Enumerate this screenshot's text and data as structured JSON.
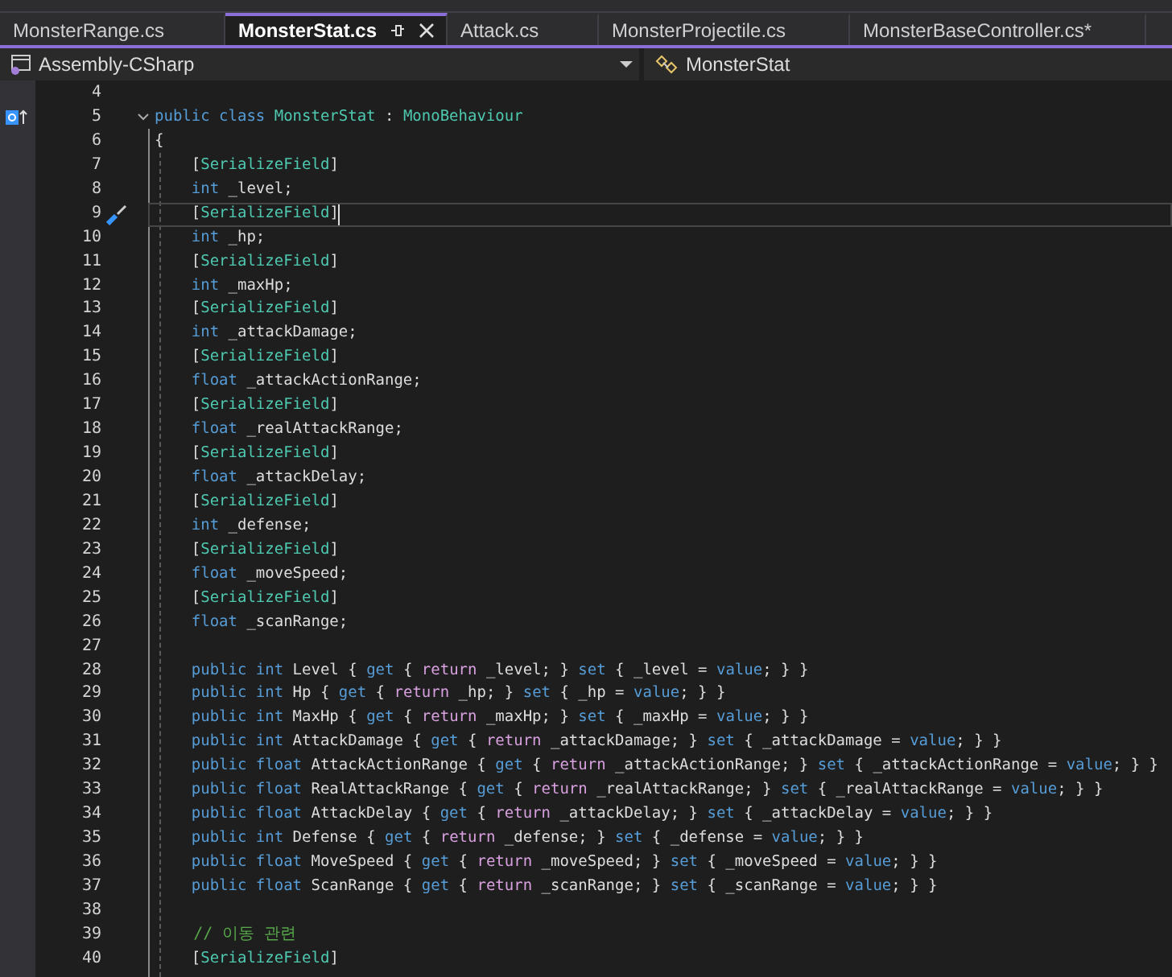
{
  "tabs": [
    {
      "label": "MonsterRange.cs",
      "selected": false
    },
    {
      "label": "MonsterStat.cs",
      "selected": true
    },
    {
      "label": "Attack.cs",
      "selected": false
    },
    {
      "label": "MonsterProjectile.cs",
      "selected": false
    },
    {
      "label": "MonsterBaseController.cs*",
      "selected": false
    }
  ],
  "navigation": {
    "project": "Assembly-CSharp",
    "type": "MonsterStat"
  },
  "lines": [
    {
      "number": "4",
      "kind": "plain",
      "current": false
    },
    {
      "number": "5",
      "kind": "declaration",
      "current": false,
      "tokens": [
        {
          "kind": "kw",
          "t": "public class "
        },
        {
          "kind": "type",
          "t": "MonsterStat"
        },
        {
          "kind": "plain",
          "t": " : "
        },
        {
          "kind": "type",
          "t": "MonoBehaviour"
        }
      ]
    },
    {
      "number": "6",
      "kind": "plain",
      "current": false,
      "tokens": [
        {
          "kind": "plain",
          "t": "{"
        }
      ]
    },
    {
      "number": "7",
      "kind": "plain",
      "current": false,
      "tokens": [
        {
          "kind": "plain",
          "t": "    ["
        },
        {
          "kind": "attr",
          "t": "SerializeField"
        },
        {
          "kind": "plain",
          "t": "]"
        }
      ]
    },
    {
      "number": "8",
      "kind": "plain",
      "current": false,
      "tokens": [
        {
          "kind": "kw",
          "t": "    int"
        },
        {
          "kind": "plain",
          "t": " _level;"
        }
      ]
    },
    {
      "number": "9",
      "kind": "quick-action",
      "current": true,
      "tokens": [
        {
          "kind": "plain",
          "t": "    ["
        },
        {
          "kind": "attr",
          "t": "SerializeField"
        },
        {
          "kind": "plain",
          "t": "]"
        }
      ]
    },
    {
      "number": "10",
      "kind": "plain",
      "current": false,
      "tokens": [
        {
          "kind": "kw",
          "t": "    int"
        },
        {
          "kind": "plain",
          "t": " _hp;"
        }
      ]
    },
    {
      "number": "11",
      "kind": "plain",
      "current": false,
      "tokens": [
        {
          "kind": "plain",
          "t": "    ["
        },
        {
          "kind": "attr",
          "t": "SerializeField"
        },
        {
          "kind": "plain",
          "t": "]"
        }
      ]
    },
    {
      "number": "12",
      "kind": "plain",
      "current": false,
      "tokens": [
        {
          "kind": "kw",
          "t": "    int"
        },
        {
          "kind": "plain",
          "t": " _maxHp;"
        }
      ]
    },
    {
      "number": "13",
      "kind": "plain",
      "current": false,
      "tokens": [
        {
          "kind": "plain",
          "t": "    ["
        },
        {
          "kind": "attr",
          "t": "SerializeField"
        },
        {
          "kind": "plain",
          "t": "]"
        }
      ]
    },
    {
      "number": "14",
      "kind": "plain",
      "current": false,
      "tokens": [
        {
          "kind": "kw",
          "t": "    int"
        },
        {
          "kind": "plain",
          "t": " _attackDamage;"
        }
      ]
    },
    {
      "number": "15",
      "kind": "plain",
      "current": false,
      "tokens": [
        {
          "kind": "plain",
          "t": "    ["
        },
        {
          "kind": "attr",
          "t": "SerializeField"
        },
        {
          "kind": "plain",
          "t": "]"
        }
      ]
    },
    {
      "number": "16",
      "kind": "plain",
      "current": false,
      "tokens": [
        {
          "kind": "kw",
          "t": "    float"
        },
        {
          "kind": "plain",
          "t": " _attackActionRange;"
        }
      ]
    },
    {
      "number": "17",
      "kind": "plain",
      "current": false,
      "tokens": [
        {
          "kind": "plain",
          "t": "    ["
        },
        {
          "kind": "attr",
          "t": "SerializeField"
        },
        {
          "kind": "plain",
          "t": "]"
        }
      ]
    },
    {
      "number": "18",
      "kind": "plain",
      "current": false,
      "tokens": [
        {
          "kind": "kw",
          "t": "    float"
        },
        {
          "kind": "plain",
          "t": " _realAttackRange;"
        }
      ]
    },
    {
      "number": "19",
      "kind": "plain",
      "current": false,
      "tokens": [
        {
          "kind": "plain",
          "t": "    ["
        },
        {
          "kind": "attr",
          "t": "SerializeField"
        },
        {
          "kind": "plain",
          "t": "]"
        }
      ]
    },
    {
      "number": "20",
      "kind": "plain",
      "current": false,
      "tokens": [
        {
          "kind": "kw",
          "t": "    float"
        },
        {
          "kind": "plain",
          "t": " _attackDelay;"
        }
      ]
    },
    {
      "number": "21",
      "kind": "plain",
      "current": false,
      "tokens": [
        {
          "kind": "plain",
          "t": "    ["
        },
        {
          "kind": "attr",
          "t": "SerializeField"
        },
        {
          "kind": "plain",
          "t": "]"
        }
      ]
    },
    {
      "number": "22",
      "kind": "plain",
      "current": false,
      "tokens": [
        {
          "kind": "kw",
          "t": "    int"
        },
        {
          "kind": "plain",
          "t": " _defense;"
        }
      ]
    },
    {
      "number": "23",
      "kind": "plain",
      "current": false,
      "tokens": [
        {
          "kind": "plain",
          "t": "    ["
        },
        {
          "kind": "attr",
          "t": "SerializeField"
        },
        {
          "kind": "plain",
          "t": "]"
        }
      ]
    },
    {
      "number": "24",
      "kind": "plain",
      "current": false,
      "tokens": [
        {
          "kind": "kw",
          "t": "    float"
        },
        {
          "kind": "plain",
          "t": " _moveSpeed;"
        }
      ]
    },
    {
      "number": "25",
      "kind": "plain",
      "current": false,
      "tokens": [
        {
          "kind": "plain",
          "t": "    ["
        },
        {
          "kind": "attr",
          "t": "SerializeField"
        },
        {
          "kind": "plain",
          "t": "]"
        }
      ]
    },
    {
      "number": "26",
      "kind": "plain",
      "current": false,
      "tokens": [
        {
          "kind": "kw",
          "t": "    float"
        },
        {
          "kind": "plain",
          "t": " _scanRange;"
        }
      ]
    },
    {
      "number": "27",
      "kind": "plain",
      "current": false
    },
    {
      "number": "28",
      "kind": "plain",
      "current": false,
      "tokens": [
        {
          "kind": "kw",
          "t": "    public int"
        },
        {
          "kind": "plain",
          "t": " Level { "
        },
        {
          "kind": "kw",
          "t": "get"
        },
        {
          "kind": "plain",
          "t": " { "
        },
        {
          "kind": "ctrl",
          "t": "return"
        },
        {
          "kind": "plain",
          "t": " _level; } "
        },
        {
          "kind": "kw",
          "t": "set"
        },
        {
          "kind": "plain",
          "t": " { _level = "
        },
        {
          "kind": "kw",
          "t": "value"
        },
        {
          "kind": "plain",
          "t": "; } }"
        }
      ]
    },
    {
      "number": "29",
      "kind": "plain",
      "current": false,
      "tokens": [
        {
          "kind": "kw",
          "t": "    public int"
        },
        {
          "kind": "plain",
          "t": " Hp { "
        },
        {
          "kind": "kw",
          "t": "get"
        },
        {
          "kind": "plain",
          "t": " { "
        },
        {
          "kind": "ctrl",
          "t": "return"
        },
        {
          "kind": "plain",
          "t": " _hp; } "
        },
        {
          "kind": "kw",
          "t": "set"
        },
        {
          "kind": "plain",
          "t": " { _hp = "
        },
        {
          "kind": "kw",
          "t": "value"
        },
        {
          "kind": "plain",
          "t": "; } }"
        }
      ]
    },
    {
      "number": "30",
      "kind": "plain",
      "current": false,
      "tokens": [
        {
          "kind": "kw",
          "t": "    public int"
        },
        {
          "kind": "plain",
          "t": " MaxHp { "
        },
        {
          "kind": "kw",
          "t": "get"
        },
        {
          "kind": "plain",
          "t": " { "
        },
        {
          "kind": "ctrl",
          "t": "return"
        },
        {
          "kind": "plain",
          "t": " _maxHp; } "
        },
        {
          "kind": "kw",
          "t": "set"
        },
        {
          "kind": "plain",
          "t": " { _maxHp = "
        },
        {
          "kind": "kw",
          "t": "value"
        },
        {
          "kind": "plain",
          "t": "; } }"
        }
      ]
    },
    {
      "number": "31",
      "kind": "plain",
      "current": false,
      "tokens": [
        {
          "kind": "kw",
          "t": "    public int"
        },
        {
          "kind": "plain",
          "t": " AttackDamage { "
        },
        {
          "kind": "kw",
          "t": "get"
        },
        {
          "kind": "plain",
          "t": " { "
        },
        {
          "kind": "ctrl",
          "t": "return"
        },
        {
          "kind": "plain",
          "t": " _attackDamage; } "
        },
        {
          "kind": "kw",
          "t": "set"
        },
        {
          "kind": "plain",
          "t": " { _attackDamage = "
        },
        {
          "kind": "kw",
          "t": "value"
        },
        {
          "kind": "plain",
          "t": "; } }"
        }
      ]
    },
    {
      "number": "32",
      "kind": "plain",
      "current": false,
      "tokens": [
        {
          "kind": "kw",
          "t": "    public float"
        },
        {
          "kind": "plain",
          "t": " AttackActionRange { "
        },
        {
          "kind": "kw",
          "t": "get"
        },
        {
          "kind": "plain",
          "t": " { "
        },
        {
          "kind": "ctrl",
          "t": "return"
        },
        {
          "kind": "plain",
          "t": " _attackActionRange; } "
        },
        {
          "kind": "kw",
          "t": "set"
        },
        {
          "kind": "plain",
          "t": " { _attackActionRange = "
        },
        {
          "kind": "kw",
          "t": "value"
        },
        {
          "kind": "plain",
          "t": "; } }"
        }
      ]
    },
    {
      "number": "33",
      "kind": "plain",
      "current": false,
      "tokens": [
        {
          "kind": "kw",
          "t": "    public float"
        },
        {
          "kind": "plain",
          "t": " RealAttackRange { "
        },
        {
          "kind": "kw",
          "t": "get"
        },
        {
          "kind": "plain",
          "t": " { "
        },
        {
          "kind": "ctrl",
          "t": "return"
        },
        {
          "kind": "plain",
          "t": " _realAttackRange; } "
        },
        {
          "kind": "kw",
          "t": "set"
        },
        {
          "kind": "plain",
          "t": " { _realAttackRange = "
        },
        {
          "kind": "kw",
          "t": "value"
        },
        {
          "kind": "plain",
          "t": "; } }"
        }
      ]
    },
    {
      "number": "34",
      "kind": "plain",
      "current": false,
      "tokens": [
        {
          "kind": "kw",
          "t": "    public float"
        },
        {
          "kind": "plain",
          "t": " AttackDelay { "
        },
        {
          "kind": "kw",
          "t": "get"
        },
        {
          "kind": "plain",
          "t": " { "
        },
        {
          "kind": "ctrl",
          "t": "return"
        },
        {
          "kind": "plain",
          "t": " _attackDelay; } "
        },
        {
          "kind": "kw",
          "t": "set"
        },
        {
          "kind": "plain",
          "t": " { _attackDelay = "
        },
        {
          "kind": "kw",
          "t": "value"
        },
        {
          "kind": "plain",
          "t": "; } }"
        }
      ]
    },
    {
      "number": "35",
      "kind": "plain",
      "current": false,
      "tokens": [
        {
          "kind": "kw",
          "t": "    public int"
        },
        {
          "kind": "plain",
          "t": " Defense { "
        },
        {
          "kind": "kw",
          "t": "get"
        },
        {
          "kind": "plain",
          "t": " { "
        },
        {
          "kind": "ctrl",
          "t": "return"
        },
        {
          "kind": "plain",
          "t": " _defense; } "
        },
        {
          "kind": "kw",
          "t": "set"
        },
        {
          "kind": "plain",
          "t": " { _defense = "
        },
        {
          "kind": "kw",
          "t": "value"
        },
        {
          "kind": "plain",
          "t": "; } }"
        }
      ]
    },
    {
      "number": "36",
      "kind": "plain",
      "current": false,
      "tokens": [
        {
          "kind": "kw",
          "t": "    public float"
        },
        {
          "kind": "plain",
          "t": " MoveSpeed { "
        },
        {
          "kind": "kw",
          "t": "get"
        },
        {
          "kind": "plain",
          "t": " { "
        },
        {
          "kind": "ctrl",
          "t": "return"
        },
        {
          "kind": "plain",
          "t": " _moveSpeed; } "
        },
        {
          "kind": "kw",
          "t": "set"
        },
        {
          "kind": "plain",
          "t": " { _moveSpeed = "
        },
        {
          "kind": "kw",
          "t": "value"
        },
        {
          "kind": "plain",
          "t": "; } }"
        }
      ]
    },
    {
      "number": "37",
      "kind": "plain",
      "current": false,
      "tokens": [
        {
          "kind": "kw",
          "t": "    public float"
        },
        {
          "kind": "plain",
          "t": " ScanRange { "
        },
        {
          "kind": "kw",
          "t": "get"
        },
        {
          "kind": "plain",
          "t": " { "
        },
        {
          "kind": "ctrl",
          "t": "return"
        },
        {
          "kind": "plain",
          "t": " _scanRange; } "
        },
        {
          "kind": "kw",
          "t": "set"
        },
        {
          "kind": "plain",
          "t": " { _scanRange = "
        },
        {
          "kind": "kw",
          "t": "value"
        },
        {
          "kind": "plain",
          "t": "; } }"
        }
      ]
    },
    {
      "number": "38",
      "kind": "plain",
      "current": false
    },
    {
      "number": "39",
      "kind": "plain",
      "current": false,
      "tokens": [
        {
          "kind": "comment",
          "t": "    // 이동 관련"
        }
      ]
    },
    {
      "number": "40",
      "kind": "plain",
      "current": false,
      "tokens": [
        {
          "kind": "plain",
          "t": "    ["
        },
        {
          "kind": "attr",
          "t": "SerializeField"
        },
        {
          "kind": "plain",
          "t": "]"
        }
      ]
    }
  ]
}
